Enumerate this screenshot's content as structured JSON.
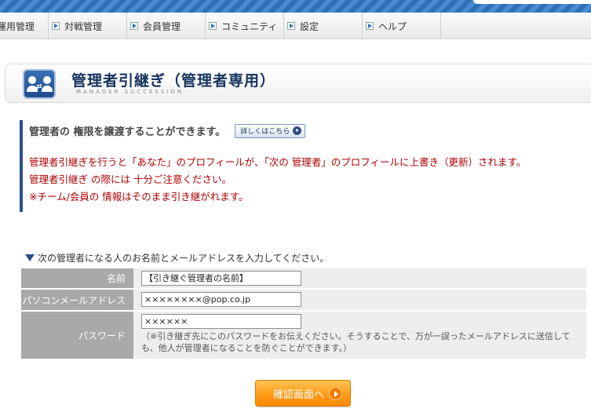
{
  "nav": {
    "items": [
      {
        "label": "運用管理"
      },
      {
        "label": "対戦管理"
      },
      {
        "label": "会員管理"
      },
      {
        "label": "コミュニティ"
      },
      {
        "label": "設定"
      },
      {
        "label": "ヘルプ"
      }
    ]
  },
  "header": {
    "title": "管理者引継ぎ（管理者専用）",
    "subtitle": "MANAGER SUCCESSION",
    "icon": "users-swap-icon"
  },
  "notice": {
    "heading": "管理者の 権限を譲渡することができます。",
    "detail_button": "詳しくはこちら",
    "line1": "管理者引継ぎを行うと「あなた」のプロフィールが、「次の 管理者」のプロフィールに上書き（更新）されます。",
    "line2": "管理者引継ぎ の際には 十分ご注意ください。",
    "line3": "※チーム/会員の 情報はそのまま引き継がれます。"
  },
  "form": {
    "intro": "次の管理者になる人のお名前とメールアドレスを入力してください。",
    "name_label": "名前",
    "name_value": "【引き継ぐ管理者の名前】",
    "mail_label": "パソコンメールアドレス",
    "mail_value": "××××××××@pop.co.jp",
    "pass_label": "パスワード",
    "pass_value": "××××××",
    "pass_note": "（※引き継ぎ先にこのパスワードをお伝えください。そうすることで、万が一誤ったメールアドレスに送信しても、他人が管理者になることを防ぐことができます。）"
  },
  "confirm_button": "確認画面へ",
  "colors": {
    "accent_blue": "#2a4f8a",
    "warning_red": "#b00000",
    "button_orange": "#ff9a18"
  }
}
